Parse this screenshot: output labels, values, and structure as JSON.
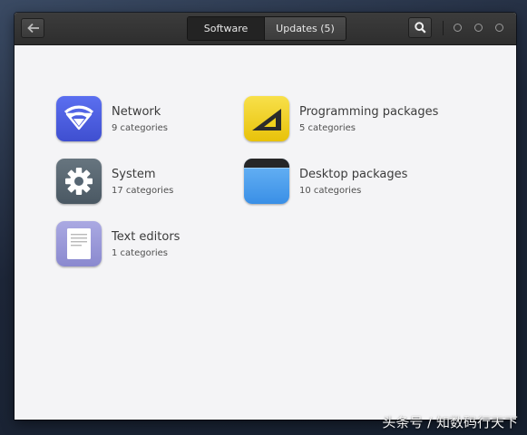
{
  "header": {
    "tabs": [
      {
        "label": "Software",
        "active": true
      },
      {
        "label": "Updates (5)",
        "active": false
      }
    ],
    "icons": {
      "back": "arrow-left-icon",
      "search": "search-icon"
    }
  },
  "categories": [
    {
      "name": "Network",
      "count": "9 categories",
      "icon": "network-icon"
    },
    {
      "name": "Programming packages",
      "count": "5 categories",
      "icon": "programming-icon"
    },
    {
      "name": "System",
      "count": "17 categories",
      "icon": "gear-icon"
    },
    {
      "name": "Desktop packages",
      "count": "10 categories",
      "icon": "desktop-icon"
    },
    {
      "name": "Text editors",
      "count": "1 categories",
      "icon": "document-icon"
    }
  ],
  "watermark": "头条号 / 知数码行天下",
  "colors": {
    "network": "#4b5ee0",
    "programming": "#f2d21c",
    "system": "#566673",
    "desktop": "#4a9ff0",
    "text_editors": "#9a9ad8"
  }
}
